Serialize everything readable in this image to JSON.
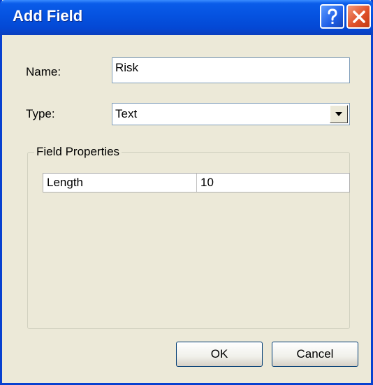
{
  "dialog": {
    "title": "Add Field",
    "help_icon": "question-mark-icon",
    "close_icon": "close-x-icon"
  },
  "name_field": {
    "label": "Name:",
    "value": "Risk"
  },
  "type_field": {
    "label": "Type:",
    "value": "Text"
  },
  "field_properties": {
    "legend": "Field Properties",
    "rows": [
      {
        "property": "Length",
        "value": "10"
      }
    ]
  },
  "buttons": {
    "ok": "OK",
    "cancel": "Cancel"
  }
}
